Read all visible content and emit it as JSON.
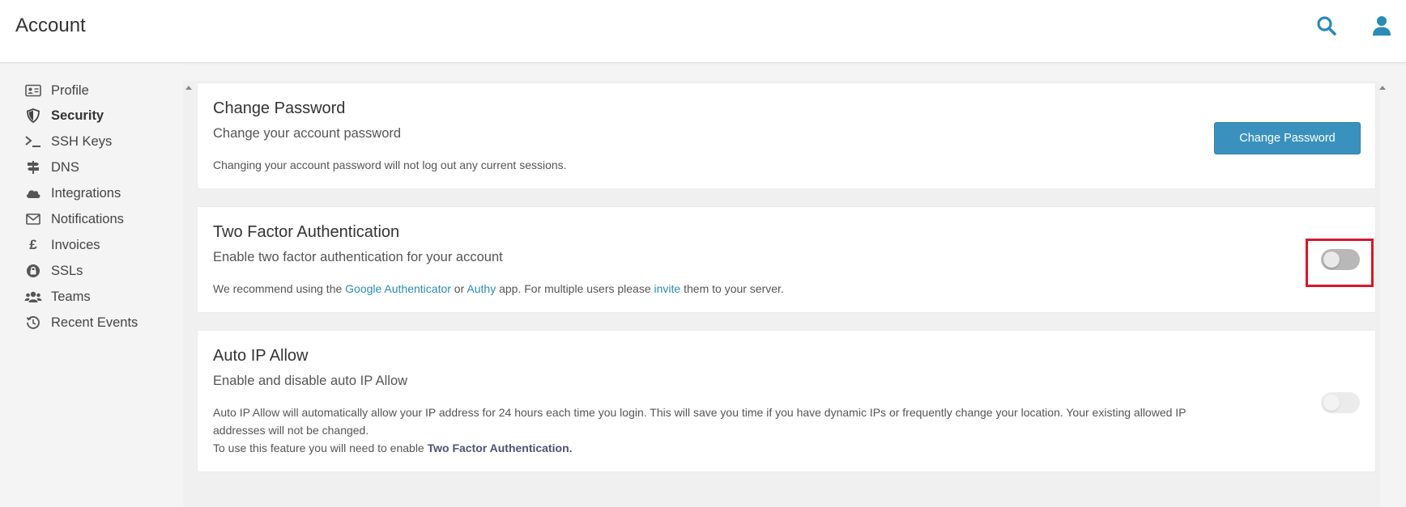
{
  "header": {
    "title": "Account",
    "search_icon": "search-icon",
    "user_icon": "user-icon"
  },
  "sidebar": {
    "items": [
      {
        "label": "Profile",
        "icon": "id-card-icon",
        "active": false
      },
      {
        "label": "Security",
        "icon": "shield-icon",
        "active": true
      },
      {
        "label": "SSH Keys",
        "icon": "terminal-icon",
        "active": false
      },
      {
        "label": "DNS",
        "icon": "signpost-icon",
        "active": false
      },
      {
        "label": "Integrations",
        "icon": "cloud-icon",
        "active": false
      },
      {
        "label": "Notifications",
        "icon": "envelope-icon",
        "active": false
      },
      {
        "label": "Invoices",
        "icon": "pound-icon",
        "active": false
      },
      {
        "label": "SSLs",
        "icon": "lock-badge-icon",
        "active": false
      },
      {
        "label": "Teams",
        "icon": "users-icon",
        "active": false
      },
      {
        "label": "Recent Events",
        "icon": "history-icon",
        "active": false
      }
    ]
  },
  "change_password": {
    "title": "Change Password",
    "subtitle": "Change your account password",
    "description": "Changing your account password will not log out any current sessions.",
    "button_label": "Change Password"
  },
  "two_factor": {
    "title": "Two Factor Authentication",
    "subtitle": "Enable two factor authentication for your account",
    "desc_part1": "We recommend using the ",
    "link_google": "Google Authenticator",
    "desc_part2": " or ",
    "link_authy": "Authy",
    "desc_part3": " app. For multiple users please ",
    "link_invite": "invite",
    "desc_part4": " them to your server.",
    "toggle_on": false
  },
  "auto_ip": {
    "title": "Auto IP Allow",
    "subtitle": "Enable and disable auto IP Allow",
    "desc_line1": "Auto IP Allow will automatically allow your IP address for 24 hours each time you login. This will save you time if you have dynamic IPs or frequently change your location. Your existing allowed IP addresses will not be changed.",
    "desc_line2_prefix": "To use this feature you will need to enable ",
    "desc_line2_bold": "Two Factor Authentication.",
    "toggle_on": false,
    "toggle_disabled": true
  },
  "colors": {
    "accent": "#3a91bd",
    "link": "#2b8bb7",
    "highlight": "#d9162b"
  }
}
